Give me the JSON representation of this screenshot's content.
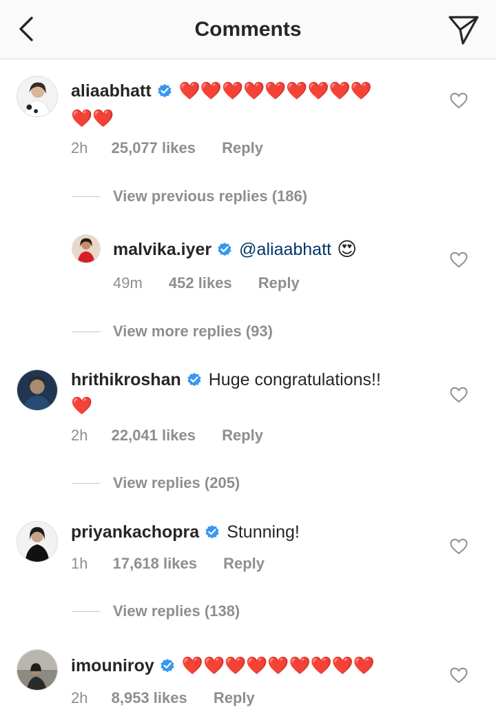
{
  "header": {
    "title": "Comments",
    "back_icon": "chevron-left-icon",
    "send_icon": "paper-plane-icon"
  },
  "comments": [
    {
      "username": "aliaabhatt",
      "verified": true,
      "hearts_line1": "❤️❤️❤️❤️❤️❤️❤️❤️❤️",
      "hearts_line2": "❤️❤️",
      "time": "2h",
      "likes": "25,077 likes",
      "reply": "Reply",
      "view_replies": "View previous replies (186)"
    },
    {
      "username": "malvika.iyer",
      "verified": true,
      "mention": "@aliaabhatt",
      "emoji": "😍",
      "time": "49m",
      "likes": "452 likes",
      "reply": "Reply",
      "view_replies": "View more replies (93)"
    },
    {
      "username": "hrithikroshan",
      "verified": true,
      "text": "Huge congratulations!!",
      "hearts_line2": "❤️",
      "time": "2h",
      "likes": "22,041 likes",
      "reply": "Reply",
      "view_replies": "View replies (205)"
    },
    {
      "username": "priyankachopra",
      "verified": true,
      "text": "Stunning!",
      "time": "1h",
      "likes": "17,618 likes",
      "reply": "Reply",
      "view_replies": "View replies (138)"
    },
    {
      "username": "imouniroy",
      "verified": true,
      "hearts_line1": "❤️❤️❤️❤️❤️❤️❤️❤️❤️",
      "time": "2h",
      "likes": "8,953 likes",
      "reply": "Reply"
    }
  ],
  "colors": {
    "text": "#262626",
    "secondary": "#8e8e8e",
    "verified": "#3897f0",
    "heart": "#ed1c3a",
    "mention": "#003569",
    "header_bg": "#fafafa"
  }
}
